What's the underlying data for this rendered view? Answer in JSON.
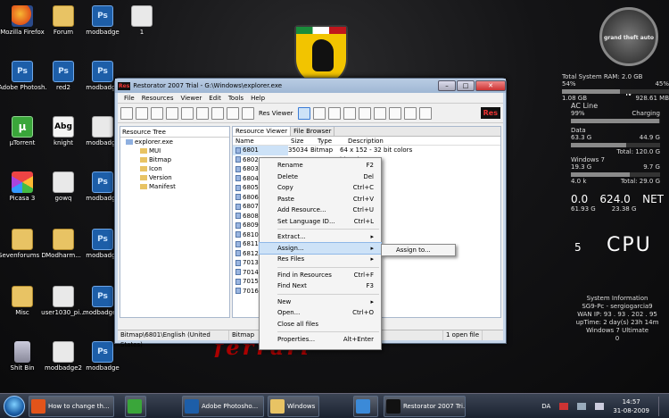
{
  "desktop_icons": [
    {
      "label": "Mozilla Firefox",
      "type": "ff",
      "line2": "Firefox",
      "line1": "Mozilla"
    },
    {
      "label": "Forum",
      "type": "folder"
    },
    {
      "label": "modbadge",
      "type": "ps",
      "glyph": "Ps"
    },
    {
      "label": "1",
      "type": "blank"
    },
    {
      "label": "Adobe Photosh...",
      "type": "ps",
      "glyph": "Ps"
    },
    {
      "label": "red2",
      "type": "ps",
      "glyph": "Ps"
    },
    {
      "label": "modbadge",
      "type": "ps",
      "glyph": "Ps"
    },
    {
      "label": "µTorrent",
      "type": "ut",
      "glyph": "µ"
    },
    {
      "label": "knight",
      "type": "doc",
      "glyph": "Abg"
    },
    {
      "label": "modbadge",
      "type": "blank"
    },
    {
      "label": "Picasa 3",
      "type": "picasa"
    },
    {
      "label": "gowq",
      "type": "blank"
    },
    {
      "label": "modbadge",
      "type": "ps",
      "glyph": "Ps"
    },
    {
      "label": "Sevenforums Designers F...",
      "type": "folder"
    },
    {
      "label": "Modharm...",
      "type": "folder"
    },
    {
      "label": "modbadge",
      "type": "ps",
      "glyph": "Ps"
    },
    {
      "label": "Misc",
      "type": "folder"
    },
    {
      "label": "user1030_pi...",
      "type": "blank"
    },
    {
      "label": "modbadge...",
      "type": "ps",
      "glyph": "Ps"
    },
    {
      "label": "Shit Bin",
      "type": "bin"
    },
    {
      "label": "modbadge2",
      "type": "blank"
    },
    {
      "label": "modbadge",
      "type": "ps",
      "glyph": "Ps"
    }
  ],
  "wallpaper": {
    "brand_text": "ferrari"
  },
  "window": {
    "title": "Restorator 2007 Trial - G:\\Windows\\explorer.exe",
    "title_badge": "Res",
    "menu": [
      "File",
      "Resources",
      "Viewer",
      "Edit",
      "Tools",
      "Help"
    ],
    "toolbar_label_viewer": "Res Viewer",
    "toolbar_badge": "Res",
    "tree_header": "Resource Tree",
    "tree": [
      "explorer.exe",
      "MUI",
      "Bitmap",
      "Icon",
      "Version",
      "Manifest"
    ],
    "tabs": [
      "Resource Viewer",
      "File Browser"
    ],
    "columns": [
      "Name",
      "Size",
      "Type",
      "Description"
    ],
    "rows": [
      {
        "name": "6801",
        "size": "35034",
        "type": "Bitmap",
        "desc": "64 x 152 - 32 bit colors"
      },
      {
        "name": "6802",
        "size": "",
        "type": "",
        "desc": "bit colors"
      },
      {
        "name": "6803",
        "size": "",
        "type": "",
        "desc": "bit colors"
      },
      {
        "name": "6804",
        "size": "",
        "type": "",
        "desc": "2 bit colors"
      },
      {
        "name": "6805",
        "size": "",
        "type": "",
        "desc": "2 bit colors"
      },
      {
        "name": "6806",
        "size": "",
        "type": "",
        "desc": "2 bit colors"
      },
      {
        "name": "6807",
        "size": "",
        "type": "",
        "desc": "2 bit colors"
      },
      {
        "name": "6808",
        "size": "",
        "type": "",
        "desc": "2 bit colors"
      },
      {
        "name": "6809",
        "size": "",
        "type": "",
        "desc": "2 bit colors"
      },
      {
        "name": "6810",
        "size": "",
        "type": "",
        "desc": "2 bit colors"
      },
      {
        "name": "6811",
        "size": "",
        "type": "",
        "desc": ""
      },
      {
        "name": "6812",
        "size": "",
        "type": "",
        "desc": ""
      },
      {
        "name": "7013",
        "size": "",
        "type": "",
        "desc": "bit colors"
      },
      {
        "name": "7014",
        "size": "",
        "type": "",
        "desc": "bit colors"
      },
      {
        "name": "7015",
        "size": "",
        "type": "",
        "desc": "bit colors"
      },
      {
        "name": "7016",
        "size": "",
        "type": "",
        "desc": "bit colors"
      }
    ],
    "status": [
      "Bitmap\\6801\\English (United States)",
      "Bitmap",
      "1 open file"
    ]
  },
  "context_menu": [
    {
      "label": "Rename",
      "key": "F2"
    },
    {
      "label": "Delete",
      "key": "Del"
    },
    {
      "label": "Copy",
      "key": "Ctrl+C"
    },
    {
      "label": "Paste",
      "key": "Ctrl+V"
    },
    {
      "label": "Add Resource...",
      "key": "Ctrl+U"
    },
    {
      "label": "Set Language ID...",
      "key": "Ctrl+L"
    },
    {
      "sep": true
    },
    {
      "label": "Extract...",
      "key": "▸"
    },
    {
      "label": "Assign...",
      "key": "▸",
      "highlight": true
    },
    {
      "label": "Res Files",
      "key": "▸"
    },
    {
      "sep": true
    },
    {
      "label": "Find in Resources",
      "key": "Ctrl+F"
    },
    {
      "label": "Find Next",
      "key": "F3"
    },
    {
      "sep": true
    },
    {
      "label": "New",
      "key": "▸"
    },
    {
      "label": "Open...",
      "key": "Ctrl+O"
    },
    {
      "label": "Close all files",
      "key": ""
    },
    {
      "sep": true
    },
    {
      "label": "Properties...",
      "key": "Alt+Enter"
    }
  ],
  "submenu": {
    "label": "Assign to..."
  },
  "gadgets": {
    "gta_text": "grand theft auto IV",
    "ram_title": "Total System RAM:  2.0 GB",
    "ram_pct_left": "54%",
    "ram_pct_right": "45%",
    "ram_used": "1.08 GB",
    "ram_free": "928.61 MB",
    "ac_title": "AC Line",
    "ac_pct": "99%",
    "ac_state": "Charging",
    "data_label": "Data",
    "data_pct": "63.3 G",
    "data_right": "44.9 G",
    "data_line2": "Total: 120.0 G",
    "win_label": "Windows 7",
    "win_left": "19.3 G",
    "win_right": "9.7 G",
    "win_line2": "4.0 k",
    "win_line2_right": "Total: 29.0 G",
    "net_left_top": "0.0",
    "net_left_bot": "61.93 G",
    "net_right_top": "624.0",
    "net_right_bot": "23.38 G",
    "net_label": "NET",
    "cpu_count": "5",
    "cpu_label": "CPU",
    "sysinfo_title": "System Information",
    "sysinfo": [
      "SG9-Pc - sergiogarcia9",
      "WAN IP: 93 . 93 . 202 . 95",
      "upTime: 2 day(s) 23h 14m",
      "Windows 7 Ultimate",
      "0"
    ]
  },
  "taskbar": {
    "tasks": [
      {
        "label": "How to change th...",
        "icon": "#e2541a"
      },
      {
        "label": "",
        "icon": "#3aa63a"
      },
      {
        "label": "Adobe Photosho...",
        "icon": "#1d5ea8"
      },
      {
        "label": "Windows",
        "icon": "#e8c364"
      },
      {
        "label": "",
        "icon": "#3b8ad8"
      },
      {
        "label": "Restorator 2007 Tri...",
        "icon": "#111"
      }
    ],
    "lang": "DA",
    "time": "14:57",
    "date": "31-08-2009"
  }
}
